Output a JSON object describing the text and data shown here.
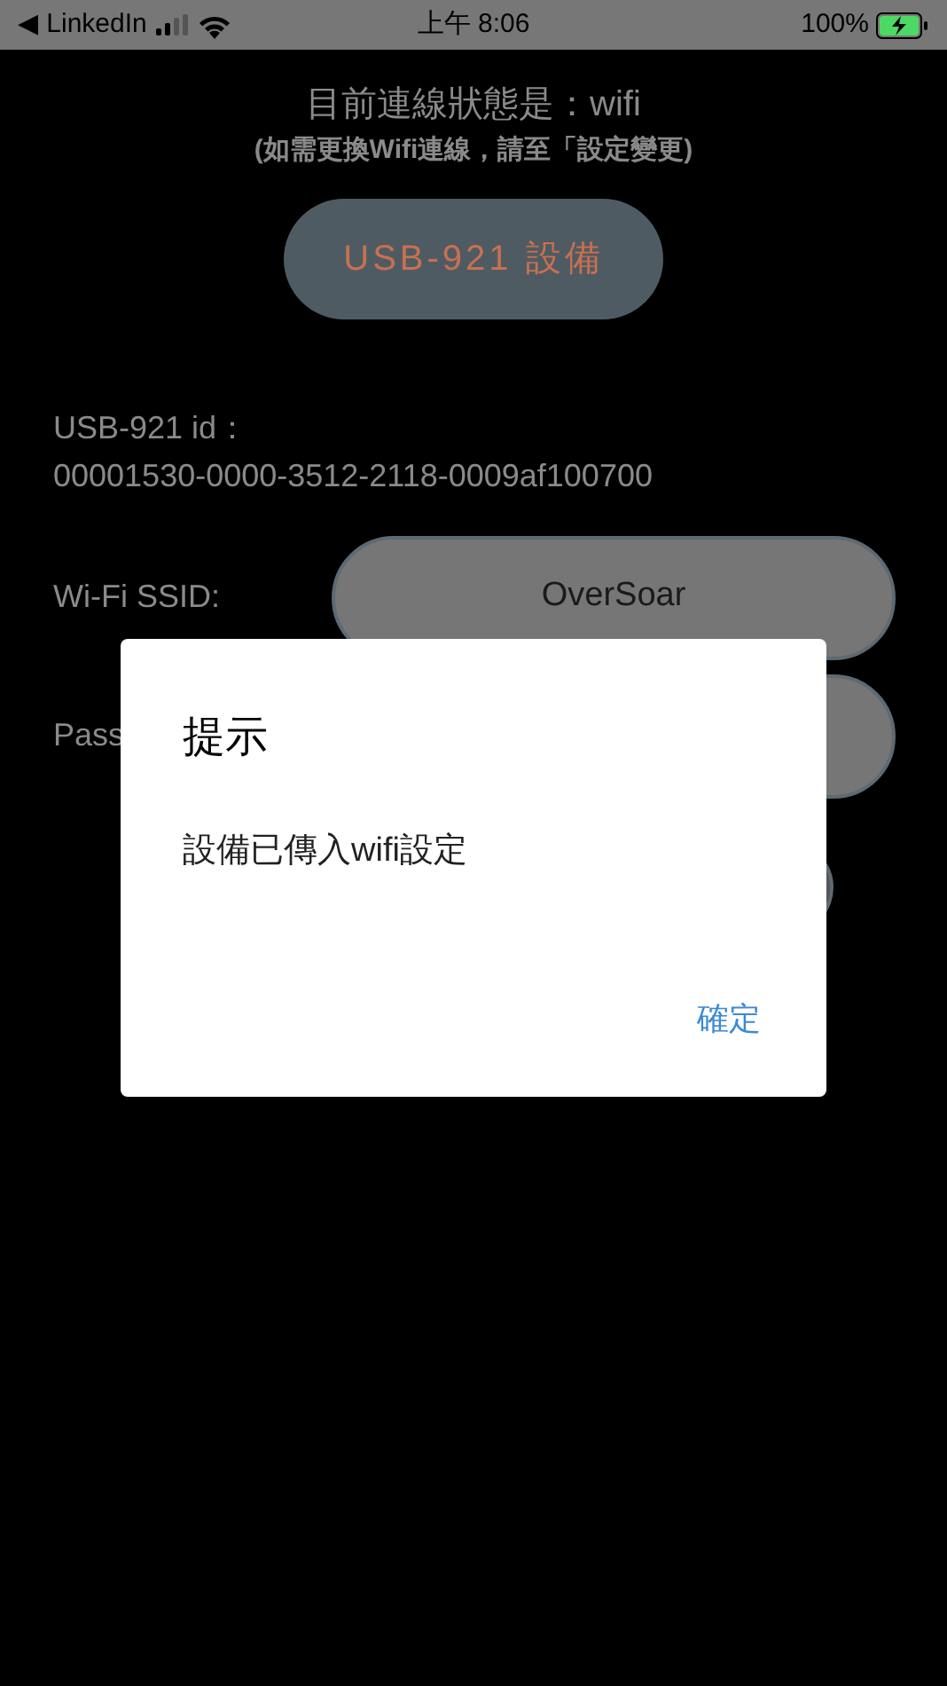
{
  "status_bar": {
    "back_app": "◀ LinkedIn",
    "time": "上午 8:06",
    "battery": "100%"
  },
  "connection": {
    "status": "目前連線狀態是：wifi",
    "hint": "(如需更換Wifi連線，請至「設定變更)"
  },
  "device_button": {
    "label": "USB-921 設備"
  },
  "device_id": {
    "label": "USB-921 id：",
    "value": "00001530-0000-3512-2118-0009af100700"
  },
  "ssid": {
    "label": "Wi-Fi SSID:",
    "value": "OverSoar"
  },
  "password": {
    "label": "Pass"
  },
  "dialog": {
    "title": "提示",
    "message": "設備已傳入wifi設定",
    "buttons": [
      "確定"
    ]
  }
}
